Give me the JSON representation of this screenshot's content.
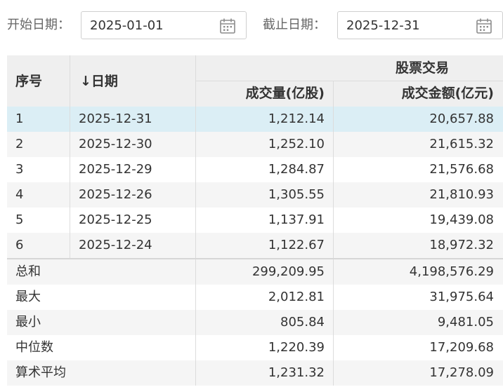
{
  "filters": {
    "start_label": "开始日期：",
    "start_value": "2025-01-01",
    "end_label": "截止日期：",
    "end_value": "2025-12-31"
  },
  "header": {
    "seq": "序号",
    "date": "↓日期",
    "group": "股票交易",
    "volume": "成交量(亿股)",
    "amount": "成交金额(亿元)"
  },
  "rows": [
    {
      "seq": "1",
      "date": "2025-12-31",
      "volume": "1,212.14",
      "amount": "20,657.88"
    },
    {
      "seq": "2",
      "date": "2025-12-30",
      "volume": "1,252.10",
      "amount": "21,615.32"
    },
    {
      "seq": "3",
      "date": "2025-12-29",
      "volume": "1,284.87",
      "amount": "21,576.68"
    },
    {
      "seq": "4",
      "date": "2025-12-26",
      "volume": "1,305.55",
      "amount": "21,810.93"
    },
    {
      "seq": "5",
      "date": "2025-12-25",
      "volume": "1,137.91",
      "amount": "19,439.08"
    },
    {
      "seq": "6",
      "date": "2025-12-24",
      "volume": "1,122.67",
      "amount": "18,972.32"
    }
  ],
  "summary": [
    {
      "label": "总和",
      "volume": "299,209.95",
      "amount": "4,198,576.29"
    },
    {
      "label": "最大",
      "volume": "2,012.81",
      "amount": "31,975.64"
    },
    {
      "label": "最小",
      "volume": "805.84",
      "amount": "9,481.05"
    },
    {
      "label": "中位数",
      "volume": "1,220.39",
      "amount": "17,209.68"
    },
    {
      "label": "算术平均",
      "volume": "1,231.32",
      "amount": "17,278.09"
    }
  ],
  "colors": {
    "header_bg": "#efefef",
    "selected_row": "#dbeef5",
    "odd_row": "#f5f5f5",
    "even_row": "#ffffff"
  }
}
